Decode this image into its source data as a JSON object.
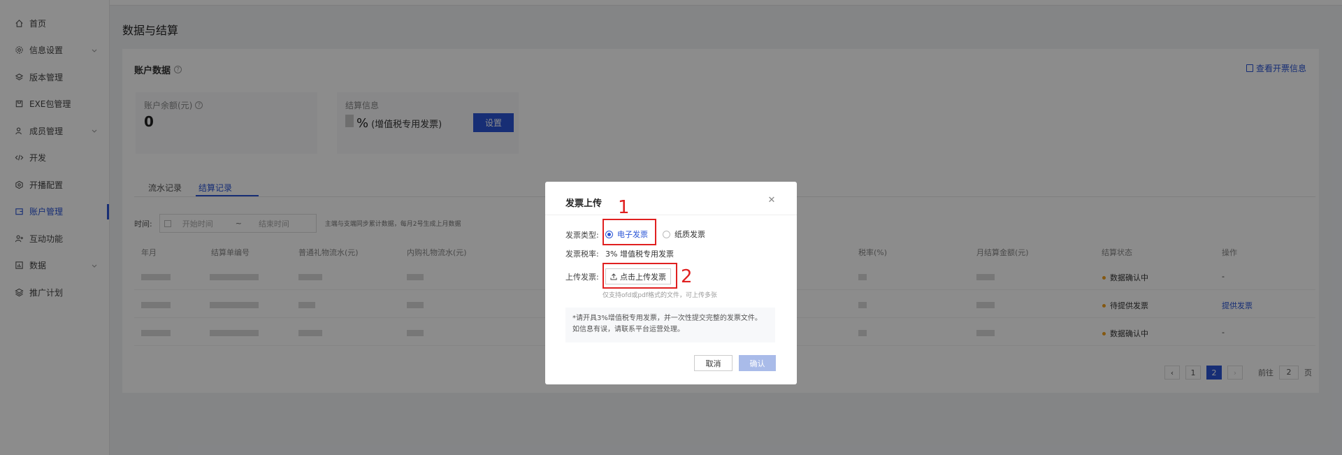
{
  "sidebar": {
    "items": [
      {
        "label": "首页",
        "icon": "home-icon",
        "has_children": false
      },
      {
        "label": "信息设置",
        "icon": "gear-icon",
        "has_children": true
      },
      {
        "label": "版本管理",
        "icon": "layers-icon",
        "has_children": false
      },
      {
        "label": "EXE包管理",
        "icon": "package-icon",
        "has_children": false
      },
      {
        "label": "成员管理",
        "icon": "users-icon",
        "has_children": true
      },
      {
        "label": "开发",
        "icon": "code-icon",
        "has_children": false
      },
      {
        "label": "开播配置",
        "icon": "hexagon-icon",
        "has_children": false
      },
      {
        "label": "账户管理",
        "icon": "wallet-icon",
        "has_children": false,
        "active": true
      },
      {
        "label": "互动功能",
        "icon": "user-plus-icon",
        "has_children": false
      },
      {
        "label": "数据",
        "icon": "bar-chart-icon",
        "has_children": true
      },
      {
        "label": "推广计划",
        "icon": "stack-icon",
        "has_children": false
      }
    ]
  },
  "page": {
    "title": "数据与结算"
  },
  "account": {
    "title": "账户数据",
    "invoice_link": "查看开票信息",
    "balance_label": "账户余额(元)",
    "balance_value": "0",
    "settlement_label": "结算信息",
    "settlement_value": "%",
    "settlement_type": "(增值税专用发票)",
    "set_button": "设置"
  },
  "tabs": [
    "流水记录",
    "结算记录"
  ],
  "filter": {
    "time_label": "时间:",
    "start_placeholder": "开始时间",
    "separator": "~",
    "end_placeholder": "结束时间",
    "hint": "主端与支端同步累计数据，每月2号生成上月数据"
  },
  "table": {
    "columns": [
      "年月",
      "结算单编号",
      "普通礼物流水(元)",
      "内购礼物流水(元)",
      "税率(%)",
      "月结算金额(元)",
      "结算状态",
      "操作"
    ],
    "rows": [
      {
        "status": "数据确认中",
        "action": "-",
        "action_is_link": false
      },
      {
        "status": "待提供发票",
        "action": "提供发票",
        "action_is_link": true
      },
      {
        "status": "数据确认中",
        "action": "-",
        "action_is_link": false
      }
    ]
  },
  "pagination": {
    "pages": [
      "1",
      "2"
    ],
    "current": "2",
    "goto_label": "前往",
    "goto_value": "2",
    "page_suffix": "页"
  },
  "dialog": {
    "title": "发票上传",
    "type_label": "发票类型:",
    "type_options": [
      "电子发票",
      "纸质发票"
    ],
    "type_selected": "电子发票",
    "rate_label": "发票税率:",
    "rate_value": "3% 增值税专用发票",
    "upload_label": "上传发票:",
    "upload_button": "点击上传发票",
    "upload_note": "仅支持ofd或pdf格式的文件，可上传多张",
    "notice": "*请开具3%增值税专用发票，并一次性提交完整的发票文件。如信息有误，请联系平台运营处理。",
    "cancel_button": "取消",
    "confirm_button": "确认"
  },
  "annotations": {
    "step1": "1",
    "step2": "2"
  },
  "colors": {
    "accent": "#2a55d6",
    "annotation": "#e02020",
    "pending_dot": "#f0a020",
    "confirm_disabled": "#a9bbe9"
  }
}
